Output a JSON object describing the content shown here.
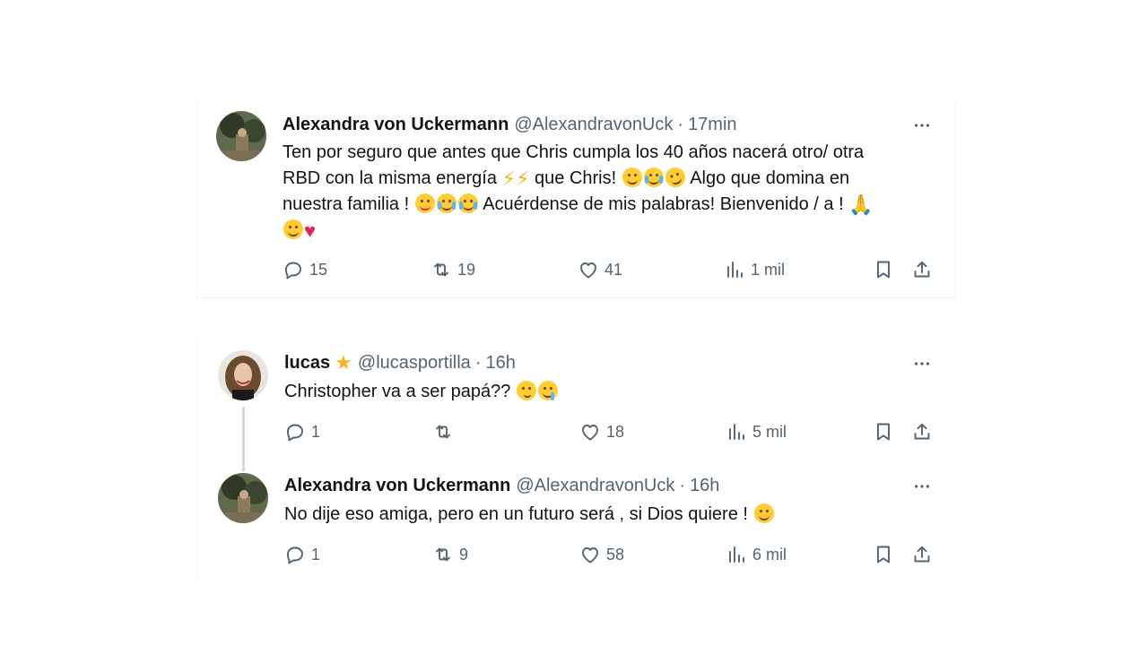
{
  "tweets": [
    {
      "name": "Alexandra von Uckermann",
      "handle": "@AlexandravonUck",
      "sep": "·",
      "time": "17min",
      "text_lines": [
        "Ten por seguro que antes que Chris cumpla los 40 años nacerá otro/ otra",
        "RBD con la misma energía",
        "que Chris!",
        "Algo que domina en",
        "nuestra familia !",
        "Acuérdense de mis palabras! Bienvenido / a !"
      ],
      "replies": "15",
      "retweets": "19",
      "likes": "41",
      "views": "1 mil"
    },
    {
      "name": "lucas",
      "handle": "@lucasportilla",
      "sep": "·",
      "time": "16h",
      "text": "Christopher va a ser papá??",
      "replies": "1",
      "retweets": "",
      "likes": "18",
      "views": "5 mil"
    },
    {
      "name": "Alexandra von Uckermann",
      "handle": "@AlexandravonUck",
      "sep": "·",
      "time": "16h",
      "text": "No dije eso amiga, pero en un futuro será , si Dios quiere !",
      "replies": "1",
      "retweets": "9",
      "likes": "58",
      "views": "6 mil"
    }
  ],
  "icons": {
    "reply": "reply-icon",
    "retweet": "retweet-icon",
    "like": "heart-icon",
    "views": "views-icon",
    "bookmark": "bookmark-icon",
    "share": "share-icon",
    "more": "more-icon"
  },
  "colors": {
    "text": "#0f1419",
    "secondary": "#536471",
    "thread_line": "#cfd9de",
    "heart_emoji": "#e0245e",
    "star": "#f5b324"
  }
}
